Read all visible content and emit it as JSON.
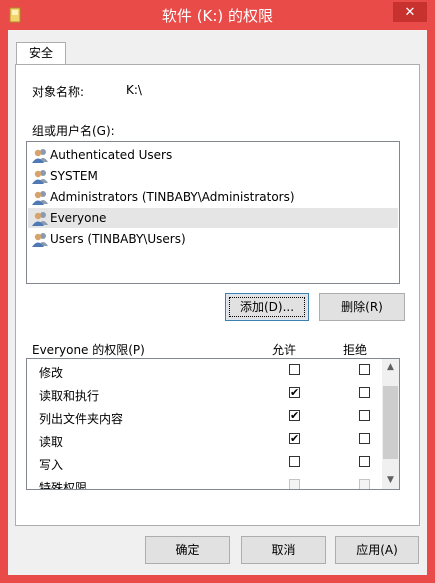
{
  "window": {
    "title": "软件 (K:) 的权限",
    "close_label": "✕"
  },
  "tabs": [
    {
      "label": "安全"
    }
  ],
  "object": {
    "label": "对象名称:",
    "value": "K:\\"
  },
  "groups": {
    "label": "组或用户名(G):",
    "items": [
      {
        "name": "Authenticated Users"
      },
      {
        "name": "SYSTEM"
      },
      {
        "name": "Administrators (TINBABY\\Administrators)"
      },
      {
        "name": "Everyone",
        "selected": true
      },
      {
        "name": "Users (TINBABY\\Users)"
      }
    ]
  },
  "buttons": {
    "add": "添加(D)...",
    "remove": "删除(R)"
  },
  "permissions": {
    "label": "Everyone 的权限(P)",
    "allow_header": "允许",
    "deny_header": "拒绝",
    "rows": [
      {
        "name": "修改",
        "allow": false,
        "deny": false
      },
      {
        "name": "读取和执行",
        "allow": true,
        "deny": false
      },
      {
        "name": "列出文件夹内容",
        "allow": true,
        "deny": false
      },
      {
        "name": "读取",
        "allow": true,
        "deny": false
      },
      {
        "name": "写入",
        "allow": false,
        "deny": false
      },
      {
        "name": "特殊权限",
        "allow": false,
        "deny": false
      }
    ]
  },
  "footer": {
    "ok": "确定",
    "cancel": "取消",
    "apply": "应用(A)"
  }
}
